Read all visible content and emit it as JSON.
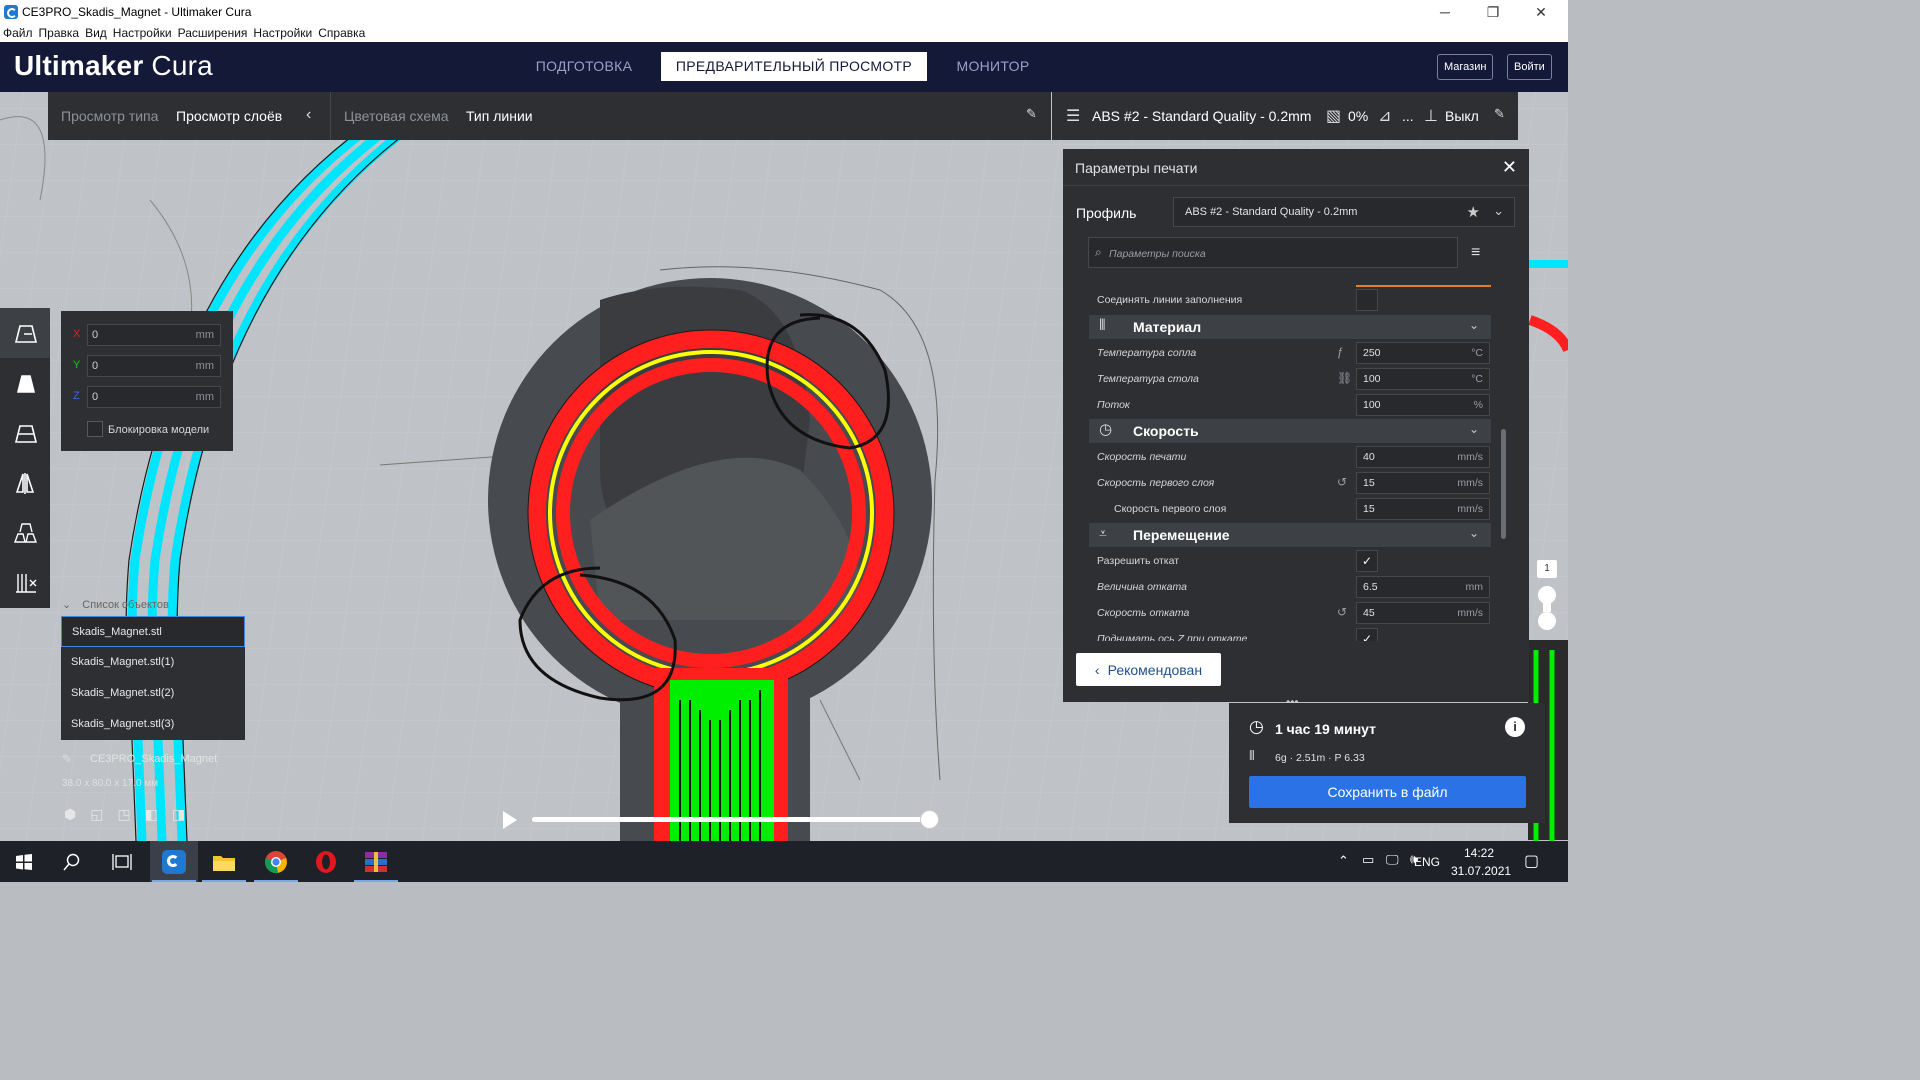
{
  "window": {
    "title": "CE3PRO_Skadis_Magnet - Ultimaker Cura",
    "controls": [
      "─",
      "❐",
      "✕"
    ]
  },
  "menu": [
    "Файл",
    "Правка",
    "Вид",
    "Настройки",
    "Расширения",
    "Настройки",
    "Справка"
  ],
  "header": {
    "brand_bold": "Ultimaker",
    "brand_light": "Cura",
    "stages": [
      "ПОДГОТОВКА",
      "ПРЕДВАРИТЕЛЬНЫЙ ПРОСМОТР",
      "МОНИТОР"
    ],
    "active_stage": "ПРЕДВАРИТЕЛЬНЫЙ ПРОСМОТР",
    "buttons": [
      "Магазин",
      "Войти"
    ]
  },
  "view_toolbar": {
    "view_type_label": "Просмотр типа",
    "view_type_value": "Просмотр слоёв",
    "color_scheme_label": "Цветовая схема",
    "color_scheme_value": "Тип линии"
  },
  "print_bar": {
    "profile": "ABS #2 - Standard Quality - 0.2mm",
    "infill": "0%",
    "support": "...",
    "adhesion": "Выкл"
  },
  "move_panel": {
    "x": {
      "axis": "X",
      "value": "0",
      "unit": "mm"
    },
    "y": {
      "axis": "Y",
      "value": "0",
      "unit": "mm"
    },
    "z": {
      "axis": "Z",
      "value": "0",
      "unit": "mm"
    },
    "lock_label": "Блокировка модели"
  },
  "object_list": {
    "header": "Список объектов",
    "items": [
      "Skadis_Magnet.stl",
      "Skadis_Magnet.stl(1)",
      "Skadis_Magnet.stl(2)",
      "Skadis_Magnet.stl(3)"
    ],
    "project_name": "CE3PRO_Skadis_Magnet",
    "dimensions": "38.0 x 80.0 x 17.0 мм"
  },
  "settings_panel": {
    "title": "Параметры печати",
    "profile_label": "Профиль",
    "profile_value": "ABS #2 - Standard Quality - 0.2mm",
    "search_placeholder": "Параметры поиска",
    "rows": {
      "connect_infill": "Соединять линии заполнения",
      "material_cat": "Материал",
      "nozzle_temp": {
        "label": "Температура сопла",
        "value": "250",
        "unit": "°C"
      },
      "bed_temp": {
        "label": "Температура стола",
        "value": "100",
        "unit": "°C"
      },
      "flow": {
        "label": "Поток",
        "value": "100",
        "unit": "%"
      },
      "speed_cat": "Скорость",
      "print_speed": {
        "label": "Скорость печати",
        "value": "40",
        "unit": "mm/s"
      },
      "first_layer_speed": {
        "label": "Скорость первого слоя",
        "value": "15",
        "unit": "mm/s"
      },
      "first_layer_speed2": {
        "label": "Скорость первого слоя",
        "value": "15",
        "unit": "mm/s"
      },
      "travel_cat": "Перемещение",
      "retraction_enable": "Разрешить откат",
      "retraction_distance": {
        "label": "Величина отката",
        "value": "6.5",
        "unit": "mm"
      },
      "retraction_speed": {
        "label": "Скорость отката",
        "value": "45",
        "unit": "mm/s"
      },
      "z_hop": "Поднимать ось Z при откате"
    },
    "recommended_button": "Рекомендован"
  },
  "estimate": {
    "time": "1 час 19 минут",
    "material": "6g · 2.51m · P 6.33",
    "save_button": "Сохранить в файл"
  },
  "layer_slider": {
    "current": "1"
  },
  "taskbar": {
    "lang": "ENG",
    "time": "14:22",
    "date": "31.07.2021"
  },
  "colors": {
    "header_bg": "#141938",
    "panel_bg": "#2d2f33",
    "accent_blue": "#2b72e6",
    "wall_outer": "#ff1f1f",
    "wall_inner": "#ffff00",
    "infill": "#00ee00",
    "skirt": "#00e5ff"
  }
}
